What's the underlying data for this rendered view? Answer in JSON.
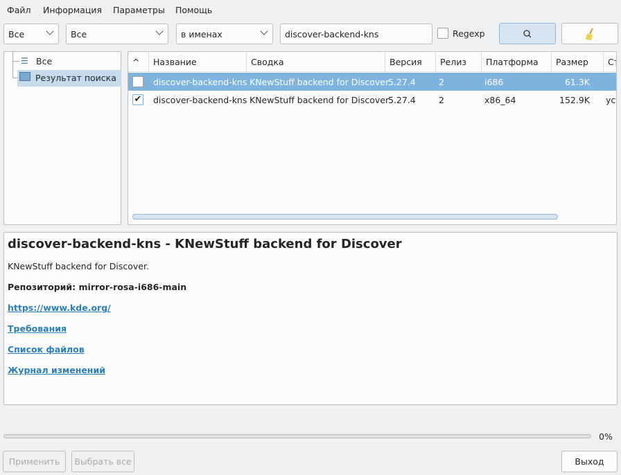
{
  "menu": [
    "Файл",
    "Информация",
    "Параметры",
    "Помощь"
  ],
  "toolbar": {
    "filter1": "Все",
    "filter2": "Все",
    "search_mode": "в именах",
    "search_value": "discover-backend-kns",
    "regexp_label": "Regexp"
  },
  "tree": {
    "items": [
      {
        "label": "Все",
        "icon": "sliders-icon"
      },
      {
        "label": "Результат поиска",
        "icon": "monitor-icon"
      }
    ]
  },
  "table": {
    "headers": [
      "Название",
      "Сводка",
      "Версия",
      "Релиз",
      "Платформа",
      "Размер",
      "Ст"
    ],
    "rows": [
      {
        "checked": false,
        "name": "discover-backend-kns",
        "summary": "KNewStuff backend for Discover",
        "version": "5.27.4",
        "release": "2",
        "platform": "i686",
        "size": "61.3K",
        "status": ""
      },
      {
        "checked": true,
        "name": "discover-backend-kns",
        "summary": "KNewStuff backend for Discover",
        "version": "5.27.4",
        "release": "2",
        "platform": "x86_64",
        "size": "152.9K",
        "status": "уст"
      }
    ]
  },
  "details": {
    "title": "discover-backend-kns - KNewStuff backend for Discover",
    "description": "KNewStuff backend for Discover.",
    "repo": "Репозиторий: mirror-rosa-i686-main",
    "url": "https://www.kde.org/",
    "requirements": "Требования",
    "files": "Список файлов",
    "changelog": "Журнал изменений"
  },
  "progress": {
    "value": 0,
    "label": "0%"
  },
  "buttons": {
    "apply": "Применить",
    "select_all": "Выбрать все",
    "exit": "Выход"
  }
}
